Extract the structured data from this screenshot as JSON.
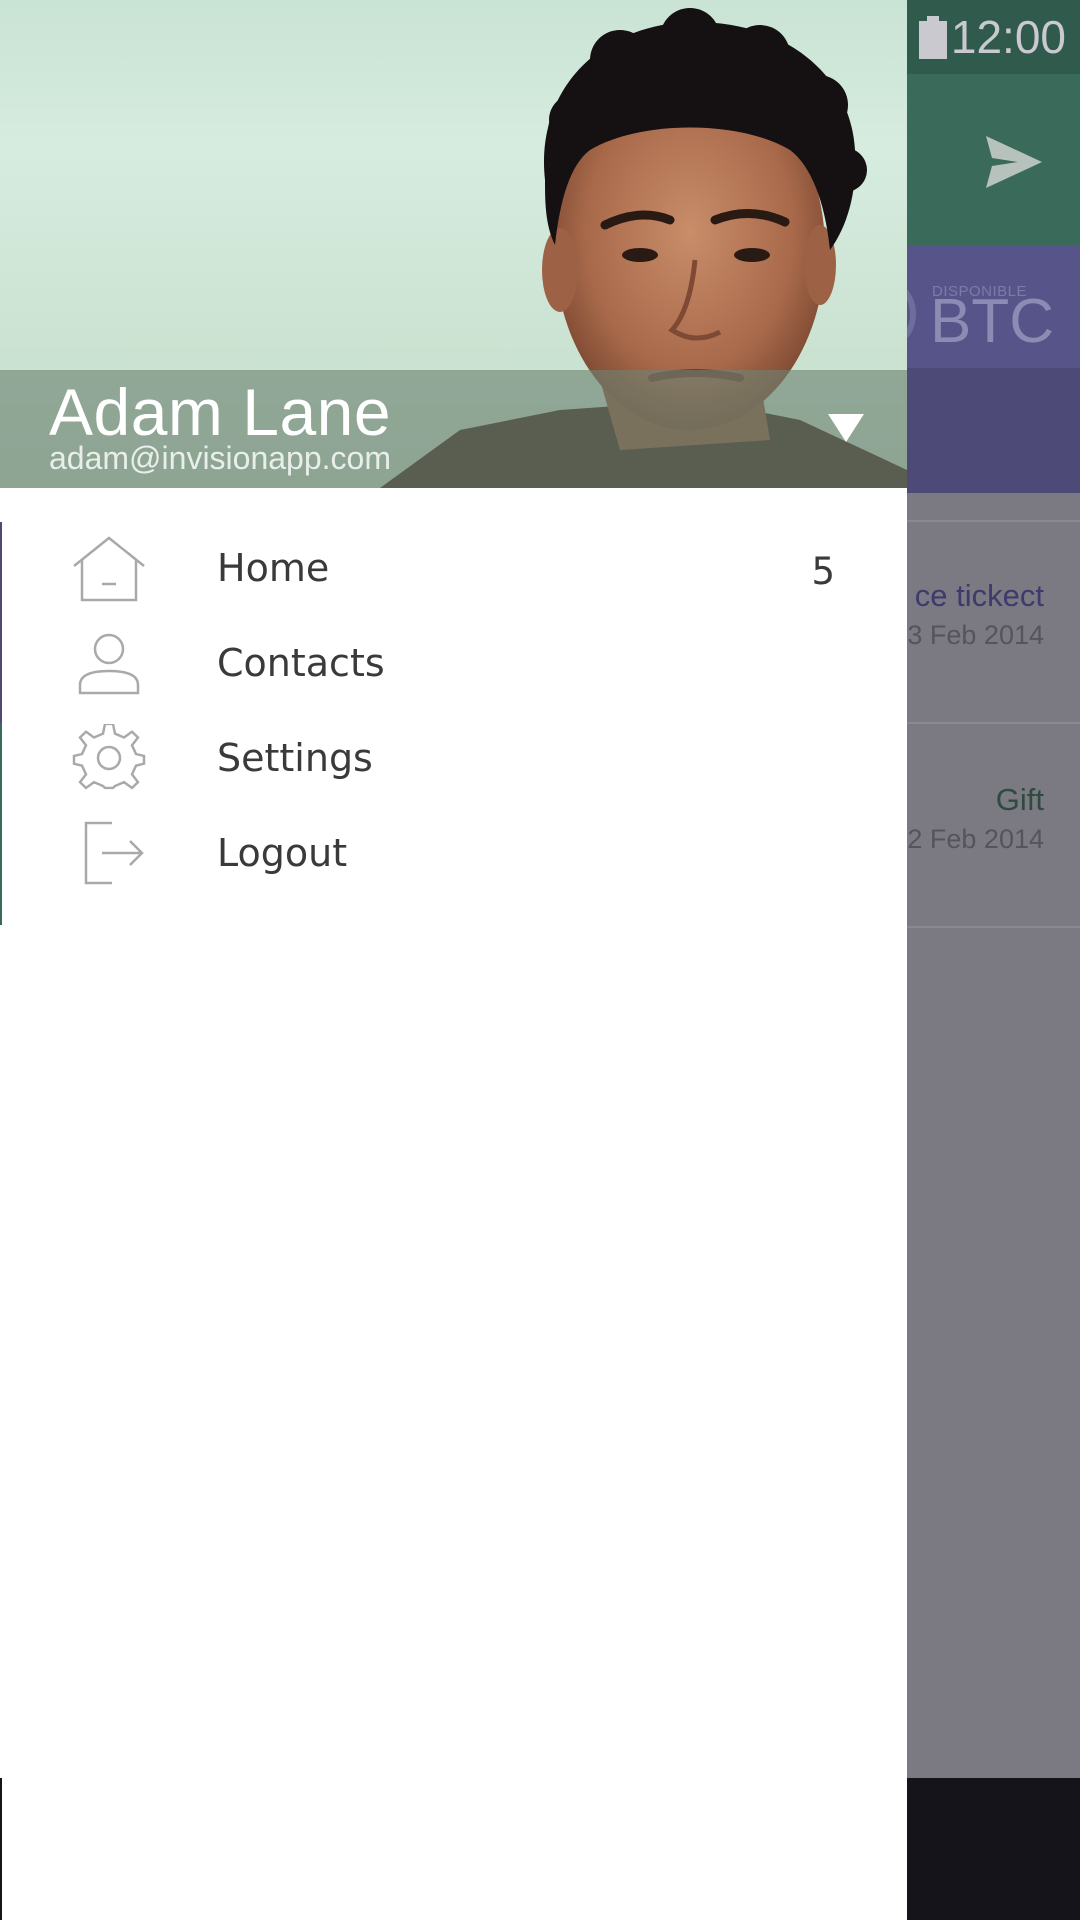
{
  "status_bar": {
    "time": "12:00",
    "battery_icon": "battery-icon"
  },
  "toolbar": {
    "send_icon": "send-icon"
  },
  "balance": {
    "caption": "DISPONIBLE",
    "currency": "BTC"
  },
  "transactions": [
    {
      "title": "ce tickect",
      "date": "3 Feb 2014",
      "title_color": "#3d3a6e"
    },
    {
      "title": "Gift",
      "date": "2 Feb 2014",
      "title_color": "#2f4a3f"
    }
  ],
  "drawer": {
    "user": {
      "name": "Adam Lane",
      "email": "adam@invisionapp.com"
    },
    "menu": [
      {
        "label": "Home",
        "icon": "home-icon",
        "count": "5"
      },
      {
        "label": "Contacts",
        "icon": "person-icon"
      },
      {
        "label": "Settings",
        "icon": "gear-icon"
      },
      {
        "label": "Logout",
        "icon": "logout-icon"
      }
    ]
  },
  "colors": {
    "status_bar": "#2f5a4c",
    "toolbar": "#3a6b5a",
    "balance": "#4d4a78",
    "scrim": "#7b7a82",
    "navbar": "#15141b",
    "drawer": "#ffffff",
    "menu_text": "#3a3a3a",
    "icon_stroke": "#a9a9a9"
  }
}
